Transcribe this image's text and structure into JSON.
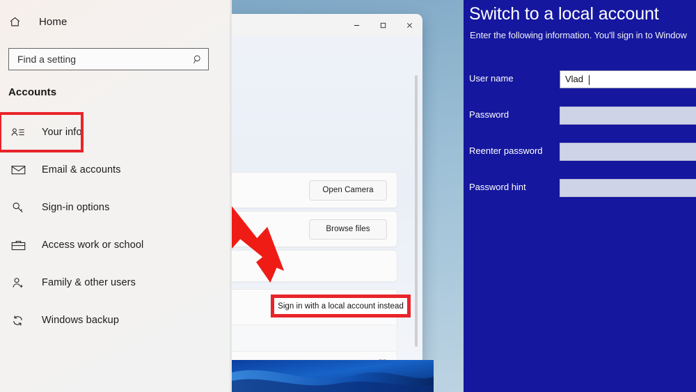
{
  "panels": {
    "left": {
      "name": "windows-settings-accounts-sidebar",
      "home": {
        "label": "Home",
        "icon": "home-icon"
      },
      "search": {
        "placeholder": "Find a setting",
        "value": "",
        "icon": "search-icon"
      },
      "section_title": "Accounts",
      "nav_items": [
        {
          "label": "Your info",
          "icon": "your-info-icon",
          "highlighted": true
        },
        {
          "label": "Email & accounts",
          "icon": "mail-icon",
          "highlighted": false
        },
        {
          "label": "Sign-in options",
          "icon": "key-icon",
          "highlighted": false
        },
        {
          "label": "Access work or school",
          "icon": "briefcase-icon",
          "highlighted": false
        },
        {
          "label": "Family & other users",
          "icon": "person-add-icon",
          "highlighted": false
        },
        {
          "label": "Windows backup",
          "icon": "sync-icon",
          "highlighted": false
        }
      ]
    },
    "middle": {
      "name": "windows-11-accounts-settings-window",
      "window_controls": [
        {
          "label": "–",
          "name": "minimize-button"
        },
        {
          "label": "☐",
          "name": "maximize-button"
        },
        {
          "label": "✕",
          "name": "close-button"
        }
      ],
      "rows": [
        {
          "button_label": "Open Camera",
          "name": "open-camera-row"
        },
        {
          "button_label": "Browse files",
          "name": "browse-files-row"
        }
      ],
      "highlighted_button": "Sign in with a local account instead",
      "external_link_icon": "open-in-new-icon",
      "annotation": {
        "arrow": "red-arrow-pointing-down-right",
        "color": "#e8242a"
      }
    },
    "right": {
      "name": "switch-to-a-local-account-dialog",
      "title": "Switch to a local account",
      "subtitle": "Enter the following information. You'll sign in to Window",
      "fields": [
        {
          "label": "User name",
          "value": "Vlad",
          "filled": true
        },
        {
          "label": "Password",
          "value": "",
          "filled": false
        },
        {
          "label": "Reenter password",
          "value": "",
          "filled": false
        },
        {
          "label": "Password hint",
          "value": "",
          "filled": false
        }
      ],
      "background_color": "#15179e"
    }
  },
  "colors": {
    "highlight_red": "#e8242a",
    "dialog_blue": "#15179e",
    "desktop_blue": "#9dc0d6"
  }
}
